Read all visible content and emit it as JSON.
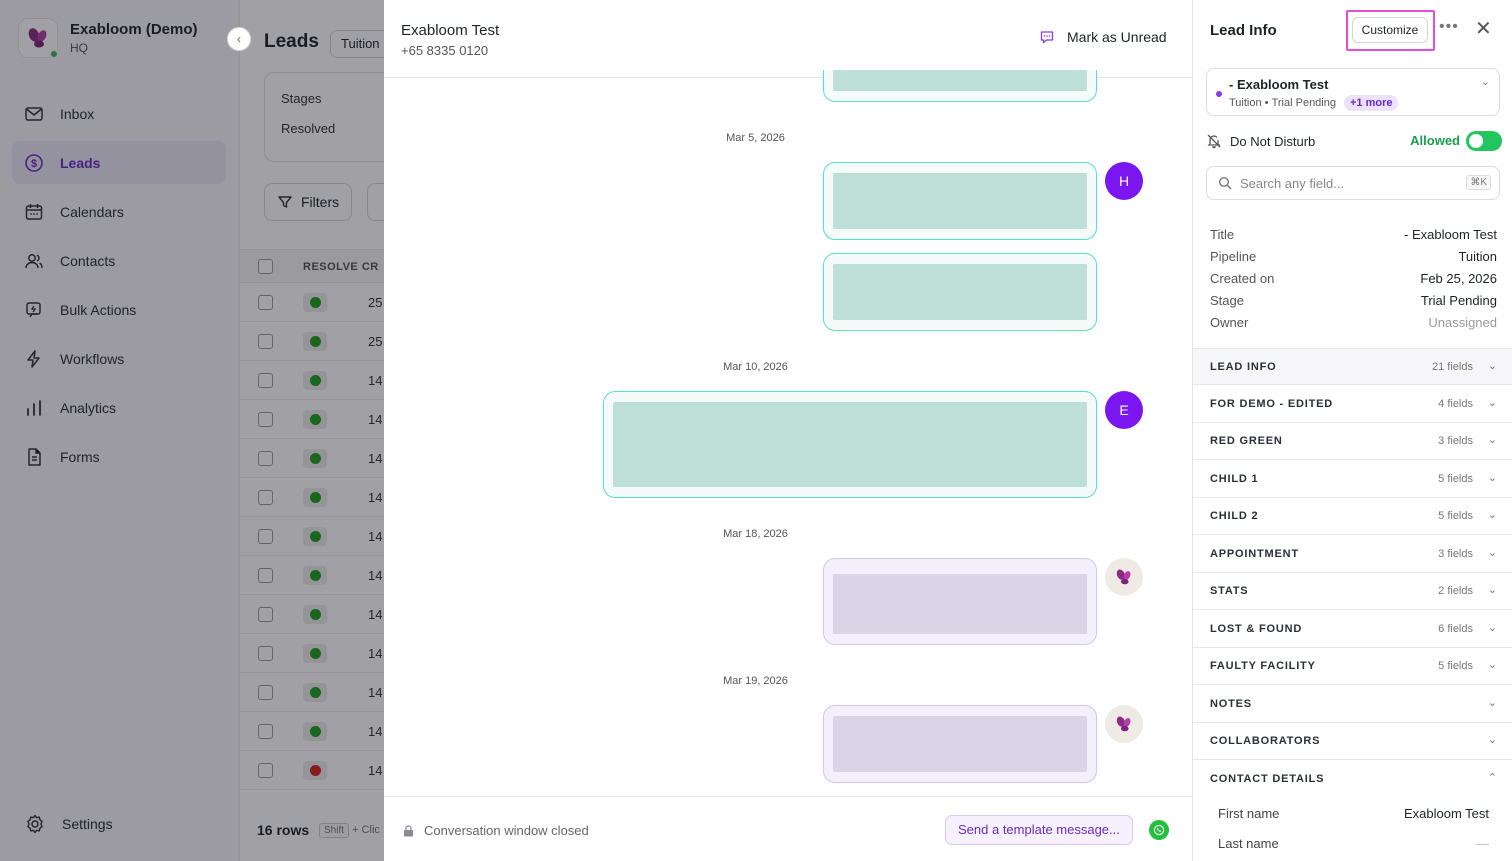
{
  "org": {
    "name": "Exabloom (Demo)",
    "sub": "HQ"
  },
  "nav": [
    {
      "id": "inbox",
      "label": "Inbox"
    },
    {
      "id": "leads",
      "label": "Leads"
    },
    {
      "id": "calendars",
      "label": "Calendars"
    },
    {
      "id": "contacts",
      "label": "Contacts"
    },
    {
      "id": "bulk-actions",
      "label": "Bulk Actions"
    },
    {
      "id": "workflows",
      "label": "Workflows"
    },
    {
      "id": "analytics",
      "label": "Analytics"
    },
    {
      "id": "forms",
      "label": "Forms"
    }
  ],
  "settings_label": "Settings",
  "leads": {
    "title": "Leads",
    "pipeline": "Tuition",
    "stages_label": "Stages",
    "resolved_label": "Resolved",
    "filters_label": "Filters",
    "col_resolved": "RESOLVE",
    "col_created": "CR",
    "rows": [
      {
        "status": "green",
        "num": "25"
      },
      {
        "status": "green",
        "num": "25"
      },
      {
        "status": "green",
        "num": "14"
      },
      {
        "status": "green",
        "num": "14"
      },
      {
        "status": "green",
        "num": "14"
      },
      {
        "status": "green",
        "num": "14"
      },
      {
        "status": "green",
        "num": "14"
      },
      {
        "status": "green",
        "num": "14"
      },
      {
        "status": "green",
        "num": "14"
      },
      {
        "status": "green",
        "num": "14"
      },
      {
        "status": "green",
        "num": "14"
      },
      {
        "status": "green",
        "num": "14"
      },
      {
        "status": "red",
        "num": "14"
      }
    ],
    "rows_count": "16 rows",
    "shift_key": "Shift",
    "shift_hint": "+ Clic"
  },
  "conversation": {
    "contact_name": "Exabloom Test",
    "contact_phone": "+65 8335 0120",
    "mark_unread": "Mark as Unread",
    "dates": [
      "Mar 5, 2026",
      "Mar 10, 2026",
      "Mar 18, 2026",
      "Mar 19, 2026"
    ],
    "avatars": [
      "H",
      "E"
    ],
    "closed_note": "Conversation window closed",
    "template_button": "Send a template message..."
  },
  "lead_info": {
    "title": "Lead Info",
    "customize": "Customize",
    "lead_name": "- Exabloom Test",
    "lead_pipeline": "Tuition",
    "lead_stage": "Trial Pending",
    "more_badge": "+1 more",
    "dnd_label": "Do Not Disturb",
    "dnd_status": "Allowed",
    "dnd_enabled": true,
    "search_placeholder": "Search any field...",
    "search_shortcut": "⌘K",
    "fields": [
      {
        "key": "Title",
        "value": "- Exabloom Test"
      },
      {
        "key": "Pipeline",
        "value": "Tuition"
      },
      {
        "key": "Created on",
        "value": "Feb 25, 2026"
      },
      {
        "key": "Stage",
        "value": "Trial Pending"
      },
      {
        "key": "Owner",
        "value": "Unassigned"
      }
    ],
    "sections": [
      {
        "name": "LEAD INFO",
        "count": "21 fields"
      },
      {
        "name": "FOR DEMO - EDITED",
        "count": "4 fields"
      },
      {
        "name": "RED GREEN",
        "count": "3 fields"
      },
      {
        "name": "CHILD 1",
        "count": "5 fields"
      },
      {
        "name": "CHILD 2",
        "count": "5 fields"
      },
      {
        "name": "APPOINTMENT",
        "count": "3 fields"
      },
      {
        "name": "STATS",
        "count": "2 fields"
      },
      {
        "name": "LOST & FOUND",
        "count": "6 fields"
      },
      {
        "name": "FAULTY FACILITY",
        "count": "5 fields"
      },
      {
        "name": "NOTES",
        "count": ""
      },
      {
        "name": "COLLABORATORS",
        "count": ""
      },
      {
        "name": "CONTACT DETAILS",
        "count": ""
      }
    ],
    "contact_details": [
      {
        "key": "First name",
        "value": "Exabloom Test"
      },
      {
        "key": "Last name",
        "value": "—"
      }
    ]
  },
  "colors": {
    "accent": "#6a2bc9",
    "avatar": "#7b16f0",
    "allowed": "#22c55e",
    "highlight": "#e64be0"
  }
}
